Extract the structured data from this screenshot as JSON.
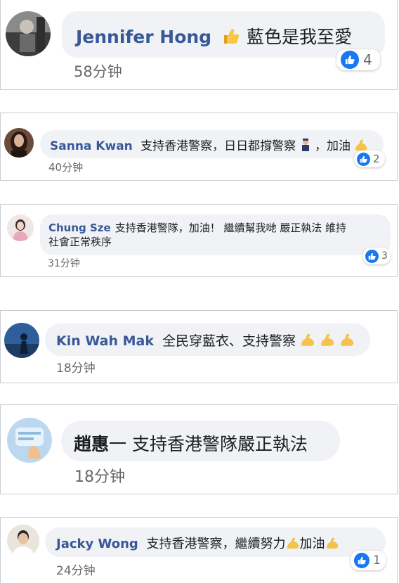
{
  "comments": [
    {
      "name": "Jennifer Hong",
      "text": "藍色是我至愛",
      "emoji": "thumbs-up",
      "time": "58分钟",
      "reactions": "4",
      "avatar_color": "#5a5a5a"
    },
    {
      "name": "Sanna Kwan",
      "text": "支持香港警察，日日都撐警察",
      "text_end": "，加油",
      "time": "40分钟",
      "reactions": "2",
      "avatar_color": "#4a2c24"
    },
    {
      "name": "Chung Sze",
      "text": "支持香港警隊，加油！ 繼續幫我哋 嚴正執法 維持",
      "text_line2": "社會正常秩序",
      "time": "31分钟",
      "reactions": "3",
      "avatar_color": "#d9c6c8"
    },
    {
      "name": "Kin Wah Mak",
      "text": "全民穿藍衣、支持警察",
      "time": "18分钟",
      "avatar_color": "#3a6fa8"
    },
    {
      "name": "趙惠",
      "text": "一 支持香港警隊嚴正執法",
      "time": "18分钟",
      "avatar_color": "#8fb9e0"
    },
    {
      "name": "Jacky Wong",
      "text": "支持香港警察，繼續努力",
      "text_end": "加油",
      "time": "24分钟",
      "reactions": "1",
      "avatar_color": "#e0d8cc"
    }
  ],
  "colors": {
    "name": "#385898",
    "bubble": "#f0f2f5",
    "like": "#1877f2",
    "muscle": "#f3c34b"
  }
}
